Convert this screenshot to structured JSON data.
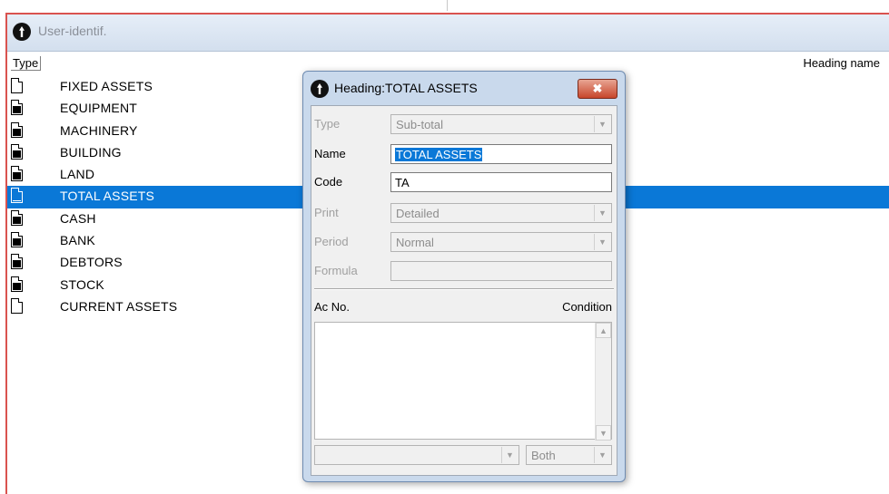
{
  "window": {
    "title": "User-identif."
  },
  "list": {
    "header_type": "Type",
    "header_name": "Heading name",
    "selected_index": 5,
    "rows": [
      {
        "label": "FIXED ASSETS",
        "icon": "document-outline-icon"
      },
      {
        "label": "EQUIPMENT",
        "icon": "document-filled-icon"
      },
      {
        "label": "MACHINERY",
        "icon": "document-filled-icon"
      },
      {
        "label": "BUILDING",
        "icon": "document-filled-icon"
      },
      {
        "label": "LAND",
        "icon": "document-filled-icon"
      },
      {
        "label": "TOTAL ASSETS",
        "icon": "document-outline-icon"
      },
      {
        "label": "CASH",
        "icon": "document-filled-icon"
      },
      {
        "label": "BANK",
        "icon": "document-filled-icon"
      },
      {
        "label": "DEBTORS",
        "icon": "document-filled-icon"
      },
      {
        "label": "STOCK",
        "icon": "document-filled-icon"
      },
      {
        "label": "CURRENT ASSETS",
        "icon": "document-outline-icon"
      }
    ]
  },
  "dialog": {
    "title": "Heading:TOTAL ASSETS",
    "close_glyph": "✖",
    "type_label": "Type",
    "type_value": "Sub-total",
    "name_label": "Name",
    "name_value": "TOTAL ASSETS",
    "code_label": "Code",
    "code_value": "TA",
    "print_label": "Print",
    "print_value": "Detailed",
    "period_label": "Period",
    "period_value": "Normal",
    "formula_label": "Formula",
    "formula_value": "",
    "acno_label": "Ac No.",
    "condition_label": "Condition",
    "bottom_combo_left_value": "",
    "bottom_combo_right_value": "Both"
  }
}
